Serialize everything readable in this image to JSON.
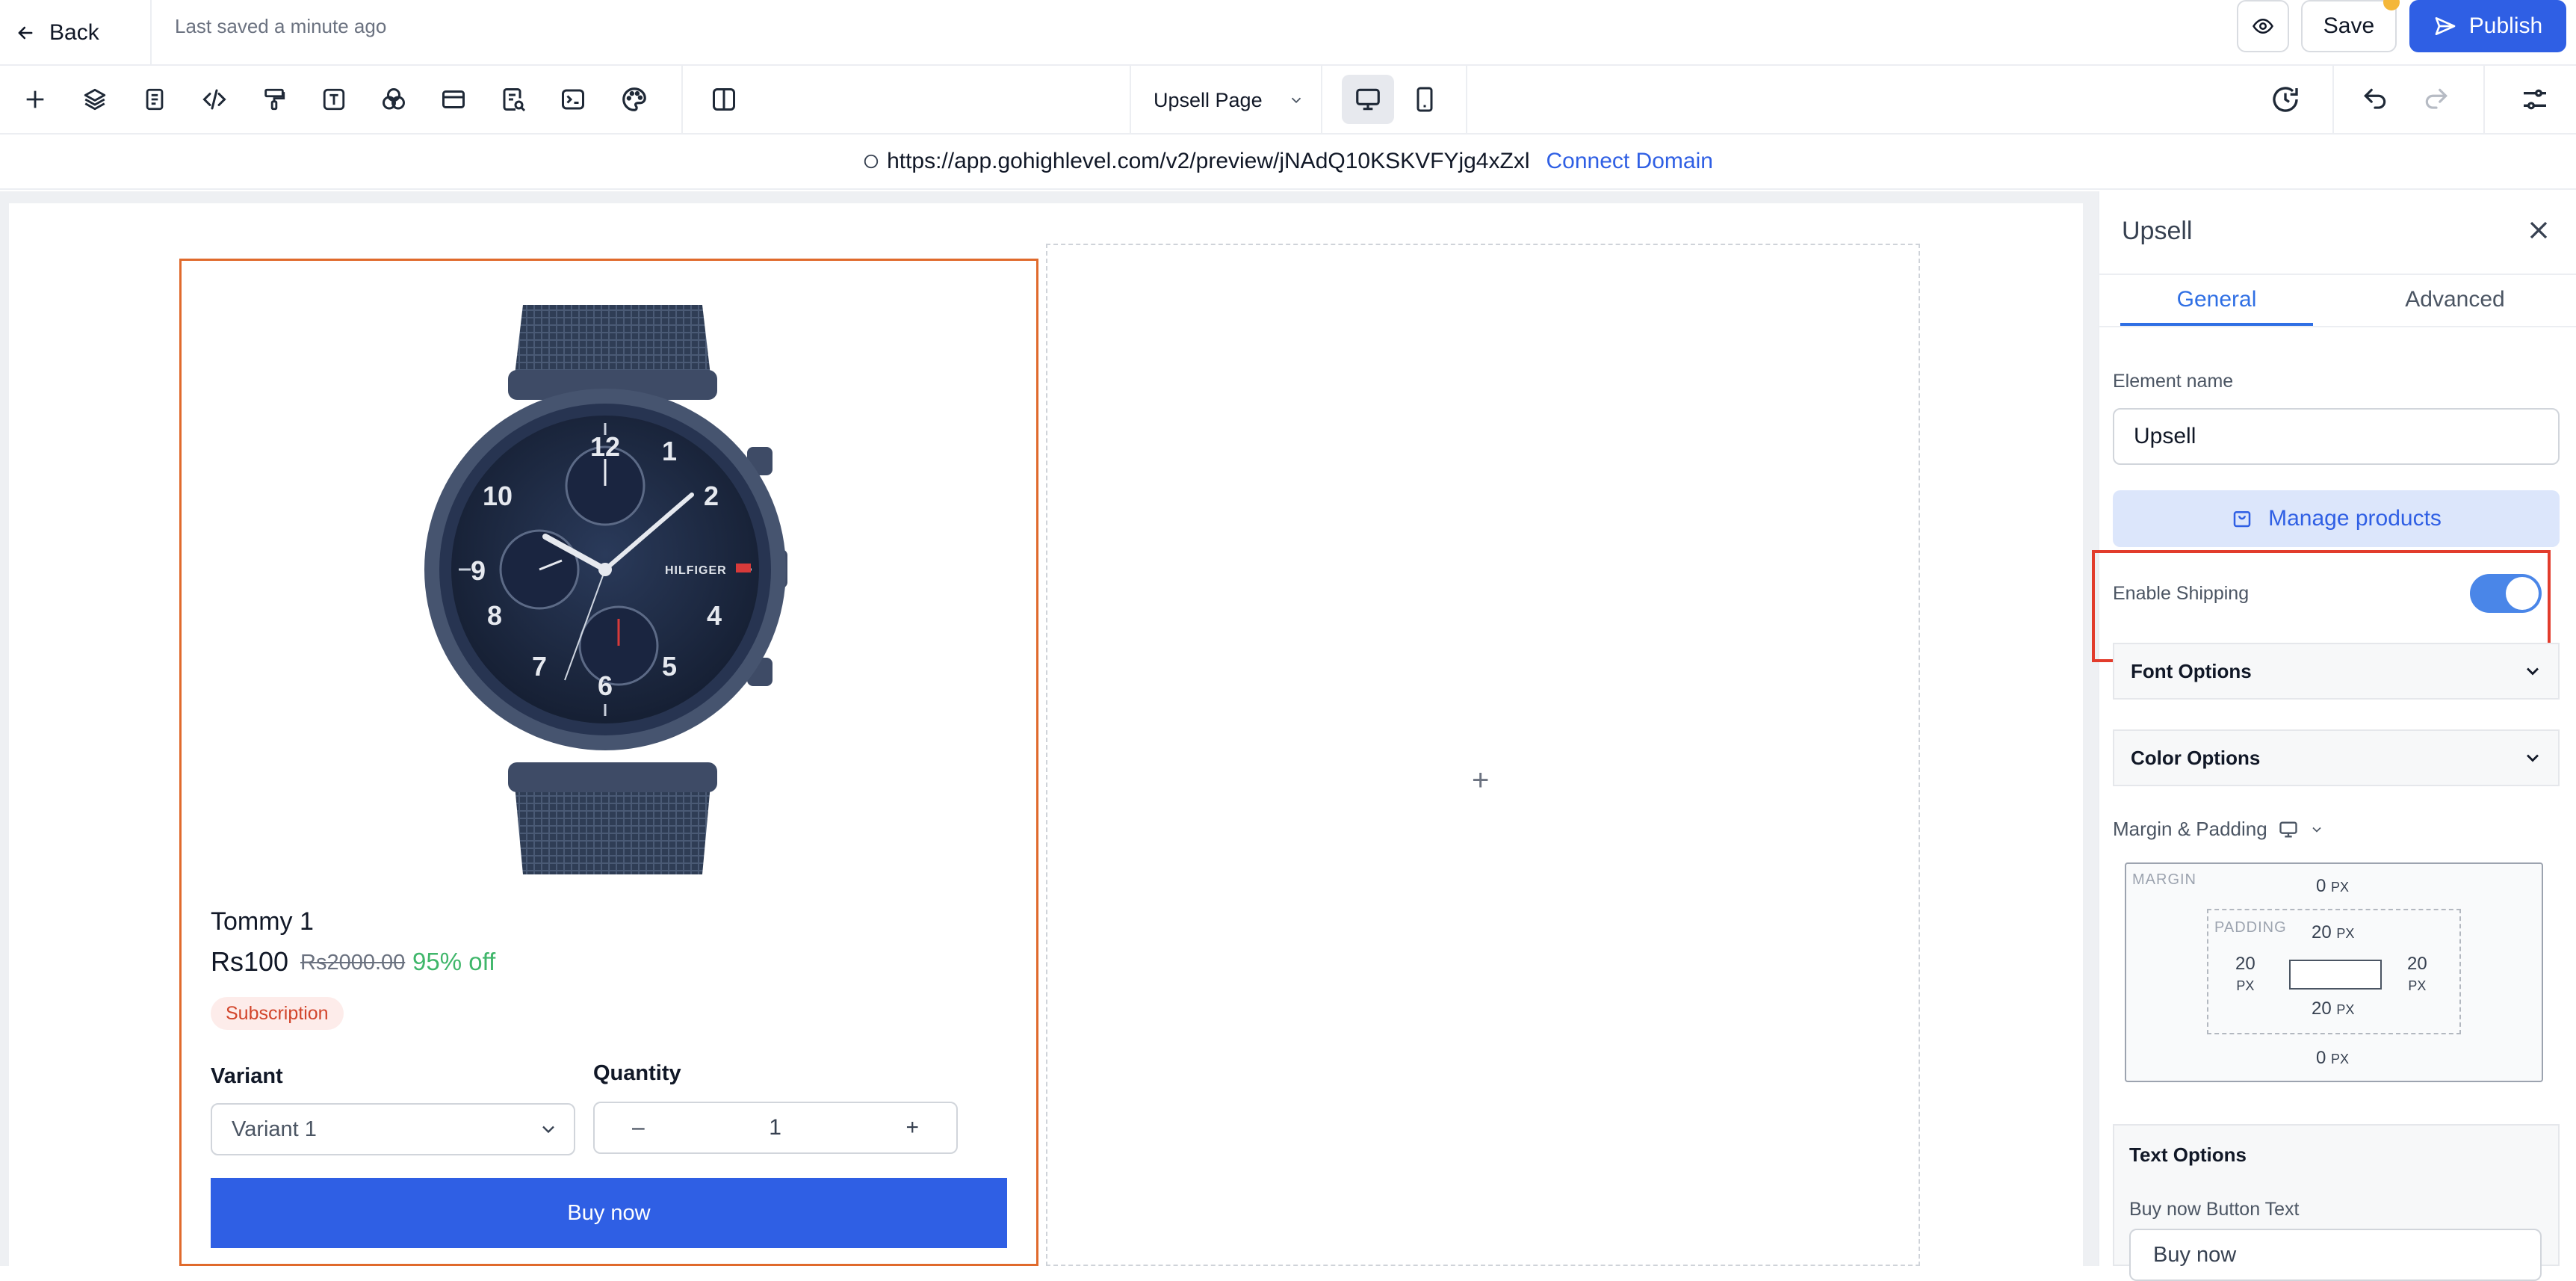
{
  "header": {
    "back_label": "Back",
    "saved_text": "Last saved a minute ago",
    "save_label": "Save",
    "publish_label": "Publish"
  },
  "toolbar": {
    "tools": [
      "add-icon",
      "layers-icon",
      "page-icon",
      "code-icon",
      "paint-roller-icon",
      "text-icon",
      "shapes-icon",
      "section-icon",
      "page-search-icon",
      "terminal-icon",
      "palette-icon",
      "columns-icon"
    ],
    "page_select": "Upsell Page"
  },
  "urlbar": {
    "url": "https://app.gohighlevel.com/v2/preview/jNAdQ10KSKVFYjg4xZxl",
    "connect_label": "Connect Domain"
  },
  "product": {
    "name": "Tommy 1",
    "price": "Rs100",
    "old_price": "Rs2000.00",
    "discount": "95% off",
    "badge": "Subscription",
    "variant_label": "Variant",
    "variant_value": "Variant 1",
    "quantity_label": "Quantity",
    "quantity_value": "1",
    "qty_minus": "–",
    "qty_plus": "+",
    "buy_label": "Buy now",
    "watch_numerals": [
      "12",
      "1",
      "2",
      "4",
      "5",
      "6",
      "7",
      "8",
      "9",
      "10"
    ],
    "watch_brand": "HILFIGER"
  },
  "canvas": {
    "add_symbol": "+"
  },
  "panel": {
    "title": "Upsell",
    "tabs": [
      "General",
      "Advanced"
    ],
    "element_name_label": "Element name",
    "element_name_value": "Upsell",
    "manage_products_label": "Manage products",
    "enable_shipping_label": "Enable Shipping",
    "enable_shipping_on": true,
    "font_options_label": "Font Options",
    "color_options_label": "Color Options",
    "margin_padding_label": "Margin & Padding",
    "margin_label": "MARGIN",
    "padding_label": "PADDING",
    "margin_top": "0",
    "margin_bottom": "0",
    "padding_top": "20",
    "padding_bottom": "20",
    "padding_left": "20",
    "padding_right": "20",
    "unit": "PX",
    "text_options_label": "Text Options",
    "buy_now_text_label": "Buy now Button Text",
    "buy_now_text_value": "Buy now"
  },
  "colors": {
    "accent": "#2f5fe4",
    "selection_border": "#e06a2c",
    "highlight": "#e23c2c",
    "discount": "#3fb66a"
  }
}
